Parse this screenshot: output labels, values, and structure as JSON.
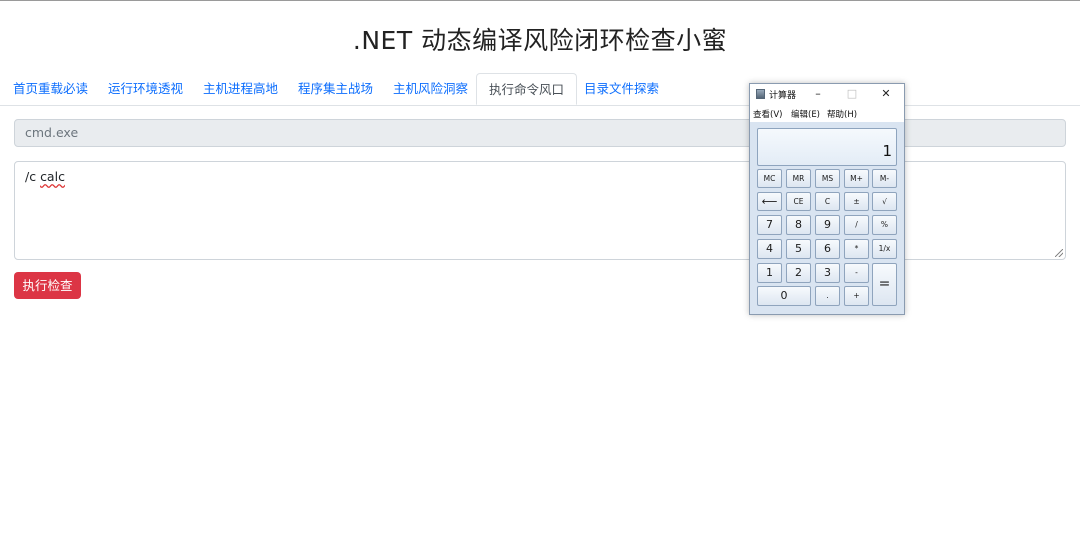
{
  "page": {
    "title": ".NET 动态编译风险闭环检查小蜜"
  },
  "tabs": [
    {
      "label": "首页重载必读"
    },
    {
      "label": "运行环境透视"
    },
    {
      "label": "主机进程高地"
    },
    {
      "label": "程序集主战场"
    },
    {
      "label": "主机风险洞察"
    },
    {
      "label": "执行命令风口",
      "active": true
    },
    {
      "label": "目录文件探索"
    }
  ],
  "form": {
    "command_value": "cmd.exe",
    "args_prefix": "/c ",
    "args_word": "calc",
    "run_label": "执行检查"
  },
  "calculator": {
    "title": "计算器",
    "window_buttons": [
      "–",
      "□",
      "✕"
    ],
    "menu": [
      "查看(V)",
      "编辑(E)",
      "帮助(H)"
    ],
    "display": "1",
    "keys": [
      [
        "MC",
        "MR",
        "MS",
        "M+",
        "M-"
      ],
      [
        "⟵",
        "CE",
        "C",
        "±",
        "√"
      ],
      [
        "7",
        "8",
        "9",
        "/",
        "%"
      ],
      [
        "4",
        "5",
        "6",
        "*",
        "1/x"
      ],
      [
        "1",
        "2",
        "3",
        "-",
        "="
      ],
      [
        "0",
        ".",
        "+"
      ]
    ]
  }
}
